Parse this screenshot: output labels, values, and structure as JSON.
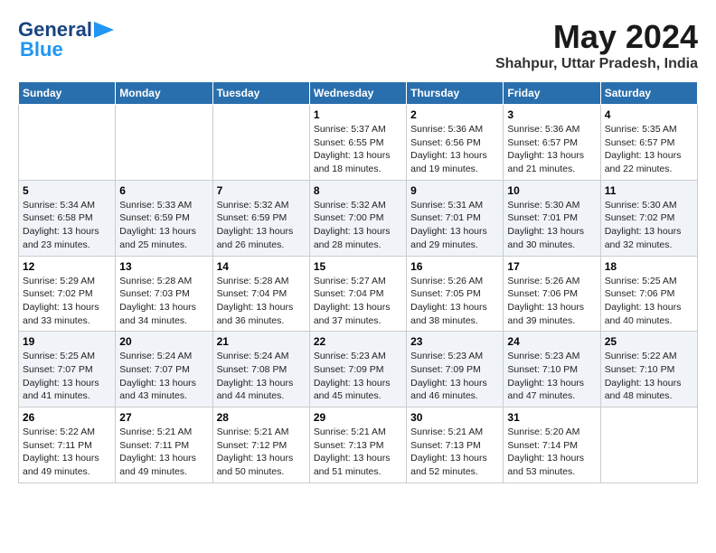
{
  "logo": {
    "text1": "General",
    "text2": "Blue"
  },
  "title": "May 2024",
  "location": "Shahpur, Uttar Pradesh, India",
  "days_of_week": [
    "Sunday",
    "Monday",
    "Tuesday",
    "Wednesday",
    "Thursday",
    "Friday",
    "Saturday"
  ],
  "weeks": [
    [
      {
        "day": "",
        "info": ""
      },
      {
        "day": "",
        "info": ""
      },
      {
        "day": "",
        "info": ""
      },
      {
        "day": "1",
        "info": "Sunrise: 5:37 AM\nSunset: 6:55 PM\nDaylight: 13 hours\nand 18 minutes."
      },
      {
        "day": "2",
        "info": "Sunrise: 5:36 AM\nSunset: 6:56 PM\nDaylight: 13 hours\nand 19 minutes."
      },
      {
        "day": "3",
        "info": "Sunrise: 5:36 AM\nSunset: 6:57 PM\nDaylight: 13 hours\nand 21 minutes."
      },
      {
        "day": "4",
        "info": "Sunrise: 5:35 AM\nSunset: 6:57 PM\nDaylight: 13 hours\nand 22 minutes."
      }
    ],
    [
      {
        "day": "5",
        "info": "Sunrise: 5:34 AM\nSunset: 6:58 PM\nDaylight: 13 hours\nand 23 minutes."
      },
      {
        "day": "6",
        "info": "Sunrise: 5:33 AM\nSunset: 6:59 PM\nDaylight: 13 hours\nand 25 minutes."
      },
      {
        "day": "7",
        "info": "Sunrise: 5:32 AM\nSunset: 6:59 PM\nDaylight: 13 hours\nand 26 minutes."
      },
      {
        "day": "8",
        "info": "Sunrise: 5:32 AM\nSunset: 7:00 PM\nDaylight: 13 hours\nand 28 minutes."
      },
      {
        "day": "9",
        "info": "Sunrise: 5:31 AM\nSunset: 7:01 PM\nDaylight: 13 hours\nand 29 minutes."
      },
      {
        "day": "10",
        "info": "Sunrise: 5:30 AM\nSunset: 7:01 PM\nDaylight: 13 hours\nand 30 minutes."
      },
      {
        "day": "11",
        "info": "Sunrise: 5:30 AM\nSunset: 7:02 PM\nDaylight: 13 hours\nand 32 minutes."
      }
    ],
    [
      {
        "day": "12",
        "info": "Sunrise: 5:29 AM\nSunset: 7:02 PM\nDaylight: 13 hours\nand 33 minutes."
      },
      {
        "day": "13",
        "info": "Sunrise: 5:28 AM\nSunset: 7:03 PM\nDaylight: 13 hours\nand 34 minutes."
      },
      {
        "day": "14",
        "info": "Sunrise: 5:28 AM\nSunset: 7:04 PM\nDaylight: 13 hours\nand 36 minutes."
      },
      {
        "day": "15",
        "info": "Sunrise: 5:27 AM\nSunset: 7:04 PM\nDaylight: 13 hours\nand 37 minutes."
      },
      {
        "day": "16",
        "info": "Sunrise: 5:26 AM\nSunset: 7:05 PM\nDaylight: 13 hours\nand 38 minutes."
      },
      {
        "day": "17",
        "info": "Sunrise: 5:26 AM\nSunset: 7:06 PM\nDaylight: 13 hours\nand 39 minutes."
      },
      {
        "day": "18",
        "info": "Sunrise: 5:25 AM\nSunset: 7:06 PM\nDaylight: 13 hours\nand 40 minutes."
      }
    ],
    [
      {
        "day": "19",
        "info": "Sunrise: 5:25 AM\nSunset: 7:07 PM\nDaylight: 13 hours\nand 41 minutes."
      },
      {
        "day": "20",
        "info": "Sunrise: 5:24 AM\nSunset: 7:07 PM\nDaylight: 13 hours\nand 43 minutes."
      },
      {
        "day": "21",
        "info": "Sunrise: 5:24 AM\nSunset: 7:08 PM\nDaylight: 13 hours\nand 44 minutes."
      },
      {
        "day": "22",
        "info": "Sunrise: 5:23 AM\nSunset: 7:09 PM\nDaylight: 13 hours\nand 45 minutes."
      },
      {
        "day": "23",
        "info": "Sunrise: 5:23 AM\nSunset: 7:09 PM\nDaylight: 13 hours\nand 46 minutes."
      },
      {
        "day": "24",
        "info": "Sunrise: 5:23 AM\nSunset: 7:10 PM\nDaylight: 13 hours\nand 47 minutes."
      },
      {
        "day": "25",
        "info": "Sunrise: 5:22 AM\nSunset: 7:10 PM\nDaylight: 13 hours\nand 48 minutes."
      }
    ],
    [
      {
        "day": "26",
        "info": "Sunrise: 5:22 AM\nSunset: 7:11 PM\nDaylight: 13 hours\nand 49 minutes."
      },
      {
        "day": "27",
        "info": "Sunrise: 5:21 AM\nSunset: 7:11 PM\nDaylight: 13 hours\nand 49 minutes."
      },
      {
        "day": "28",
        "info": "Sunrise: 5:21 AM\nSunset: 7:12 PM\nDaylight: 13 hours\nand 50 minutes."
      },
      {
        "day": "29",
        "info": "Sunrise: 5:21 AM\nSunset: 7:13 PM\nDaylight: 13 hours\nand 51 minutes."
      },
      {
        "day": "30",
        "info": "Sunrise: 5:21 AM\nSunset: 7:13 PM\nDaylight: 13 hours\nand 52 minutes."
      },
      {
        "day": "31",
        "info": "Sunrise: 5:20 AM\nSunset: 7:14 PM\nDaylight: 13 hours\nand 53 minutes."
      },
      {
        "day": "",
        "info": ""
      }
    ]
  ]
}
